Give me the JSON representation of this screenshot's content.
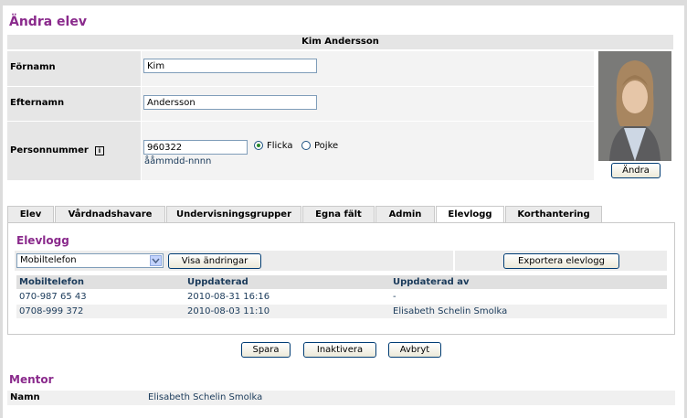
{
  "header": {
    "title": "Ändra elev"
  },
  "student": {
    "full_name": "Kim Andersson",
    "labels": {
      "firstname": "Förnamn",
      "lastname": "Efternamn",
      "personnr": "Personnummer"
    },
    "values": {
      "firstname": "Kim",
      "lastname": "Andersson",
      "personnr": "960322"
    },
    "personnr_hint": "ååmmdd-nnnn",
    "gender": {
      "options": [
        "Flicka",
        "Pojke"
      ],
      "selected": "Flicka"
    },
    "info_icon_glyph": "i",
    "photo_change_label": "Ändra"
  },
  "tabs": [
    {
      "label": "Elev"
    },
    {
      "label": "Vårdnadshavare"
    },
    {
      "label": "Undervisningsgrupper"
    },
    {
      "label": "Egna fält"
    },
    {
      "label": "Admin"
    },
    {
      "label": "Elevlogg",
      "active": true
    },
    {
      "label": "Korthantering"
    }
  ],
  "elevlogg": {
    "title": "Elevlogg",
    "filter_value": "Mobiltelefon",
    "show_changes_label": "Visa ändringar",
    "export_label": "Exportera elevlogg",
    "columns": [
      "Mobiltelefon",
      "Uppdaterad",
      "Uppdaterad av"
    ],
    "rows": [
      [
        "070-987 65 43",
        "2010-08-31 16:16",
        "-"
      ],
      [
        "0708-999 372",
        "2010-08-03 11:10",
        "Elisabeth Schelin Smolka"
      ]
    ]
  },
  "actions": {
    "save": "Spara",
    "deactivate": "Inaktivera",
    "cancel": "Avbryt"
  },
  "mentor": {
    "title": "Mentor",
    "label": "Namn",
    "value": "Elisabeth Schelin Smolka"
  },
  "colors": {
    "heading": "#8a2a8c",
    "table_text": "#1a3a5a",
    "button_border": "#003c74"
  }
}
